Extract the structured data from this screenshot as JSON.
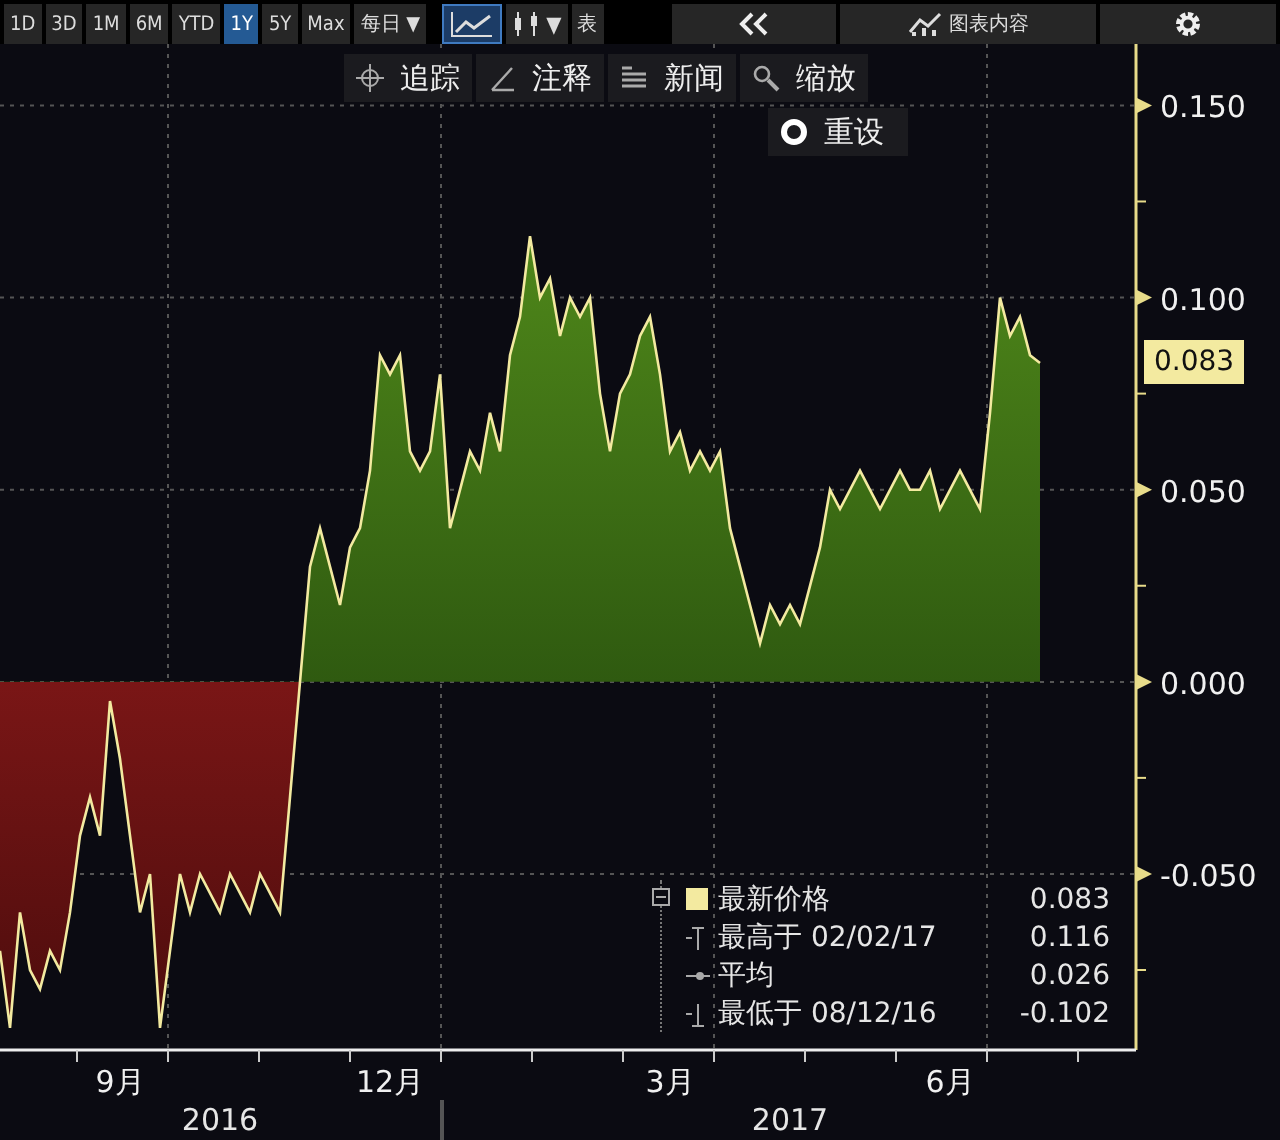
{
  "toolbar": {
    "periods": [
      {
        "label": "1D",
        "selected": false
      },
      {
        "label": "3D",
        "selected": false
      },
      {
        "label": "1M",
        "selected": false
      },
      {
        "label": "6M",
        "selected": false
      },
      {
        "label": "YTD",
        "selected": false
      },
      {
        "label": "1Y",
        "selected": true
      },
      {
        "label": "5Y",
        "selected": false
      },
      {
        "label": "Max",
        "selected": false
      }
    ],
    "frequency": "每日 ▼",
    "chart_types": [
      {
        "kind": "line",
        "selected": true
      },
      {
        "kind": "candle",
        "selected": false
      }
    ],
    "candle_caret": "▼",
    "table_button": "表",
    "content_button": "图表内容"
  },
  "tools": [
    {
      "kind": "crosshair",
      "label": "追踪"
    },
    {
      "kind": "pen",
      "label": "注释"
    },
    {
      "kind": "list",
      "label": "新闻"
    },
    {
      "kind": "zoom",
      "label": "缩放"
    }
  ],
  "reset_button": "重设",
  "chart": {
    "last_value": "0.083",
    "years": [
      "2016",
      "2017"
    ],
    "chart_data": {
      "type": "area",
      "grid": true,
      "categories": [
        null,
        null,
        null,
        null,
        null,
        null,
        null,
        null,
        null,
        null,
        null,
        null,
        "9月",
        null,
        null,
        null,
        null,
        null,
        null,
        null,
        null,
        null,
        null,
        null,
        null,
        null,
        null,
        null,
        null,
        null,
        null,
        null,
        null,
        null,
        null,
        null,
        null,
        null,
        null,
        "12月",
        null,
        null,
        null,
        null,
        null,
        null,
        null,
        null,
        null,
        null,
        null,
        null,
        null,
        null,
        null,
        null,
        null,
        null,
        null,
        null,
        null,
        null,
        null,
        null,
        null,
        null,
        null,
        "3月",
        null,
        null,
        null,
        null,
        null,
        null,
        null,
        null,
        null,
        null,
        null,
        null,
        null,
        null,
        null,
        null,
        null,
        null,
        null,
        null,
        null,
        null,
        null,
        null,
        null,
        null,
        null,
        "6月",
        null,
        null,
        null,
        null,
        null,
        null,
        null,
        null,
        null
      ],
      "ylim": [
        -0.0958,
        0.166
      ],
      "yticks": [
        {
          "value": 0.15,
          "label": "0.150"
        },
        {
          "value": 0.1,
          "label": "0.100"
        },
        {
          "value": 0.05,
          "label": "0.050"
        },
        {
          "value": 0,
          "label": "0.000"
        },
        {
          "value": -0.05,
          "label": "-0.050"
        }
      ],
      "series": [
        {
          "name": "最新价格",
          "color": "#f3eaa0",
          "values": [
            -0.07,
            -0.09,
            -0.06,
            -0.075,
            -0.08,
            -0.07,
            -0.075,
            -0.06,
            -0.04,
            -0.03,
            -0.04,
            -0.005,
            -0.02,
            -0.04,
            -0.06,
            -0.05,
            -0.09,
            -0.07,
            -0.05,
            -0.06,
            -0.05,
            -0.055,
            -0.06,
            -0.05,
            -0.055,
            -0.06,
            -0.05,
            -0.055,
            -0.06,
            -0.03,
            0.0,
            0.03,
            0.04,
            0.03,
            0.02,
            0.035,
            0.04,
            0.055,
            0.085,
            0.08,
            0.085,
            0.06,
            0.055,
            0.06,
            0.08,
            0.04,
            0.05,
            0.06,
            0.055,
            0.07,
            0.06,
            0.085,
            0.095,
            0.116,
            0.1,
            0.105,
            0.09,
            0.1,
            0.095,
            0.1,
            0.075,
            0.06,
            0.075,
            0.08,
            0.09,
            0.095,
            0.08,
            0.06,
            0.065,
            0.055,
            0.06,
            0.055,
            0.06,
            0.04,
            0.03,
            0.02,
            0.01,
            0.02,
            0.015,
            0.02,
            0.015,
            0.025,
            0.035,
            0.05,
            0.045,
            0.05,
            0.055,
            0.05,
            0.045,
            0.05,
            0.055,
            0.05,
            0.05,
            0.055,
            0.045,
            0.05,
            0.055,
            0.05,
            0.045,
            0.07,
            0.1,
            0.09,
            0.095,
            0.085,
            0.083
          ]
        }
      ]
    }
  },
  "legend": [
    {
      "kind": "latest",
      "value": "0.083",
      "color": "#f3eaa0"
    },
    {
      "kind": "high",
      "label": "最高于 02/02/17",
      "value": "0.116"
    },
    {
      "kind": "average",
      "label": "平均",
      "value": "0.026"
    },
    {
      "kind": "low",
      "label": "最低于 08/12/16",
      "value": "-0.102"
    }
  ]
}
